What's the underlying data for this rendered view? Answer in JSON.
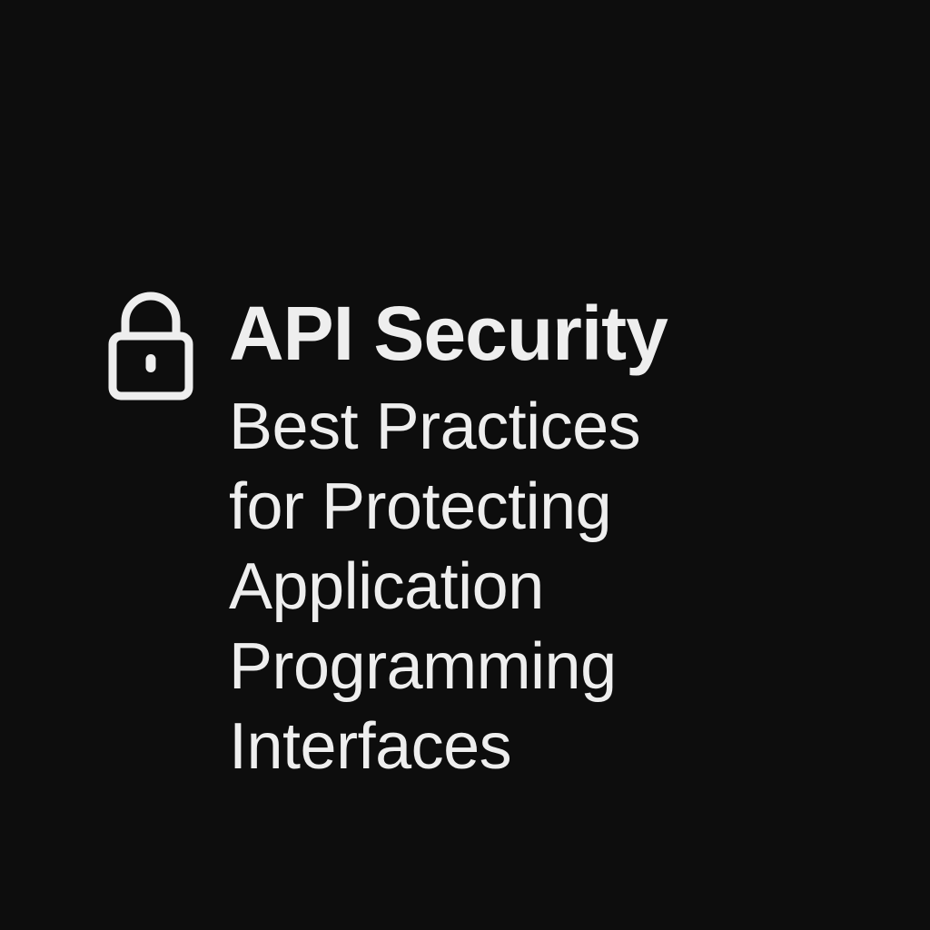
{
  "colors": {
    "background": "#0d0d0d",
    "foreground": "#eeeeee"
  },
  "icon": {
    "name": "lock-icon"
  },
  "title": "API Security",
  "subtitle_lines": [
    "Best Practices",
    "for Protecting",
    "Application",
    "Programming",
    "Interfaces"
  ]
}
